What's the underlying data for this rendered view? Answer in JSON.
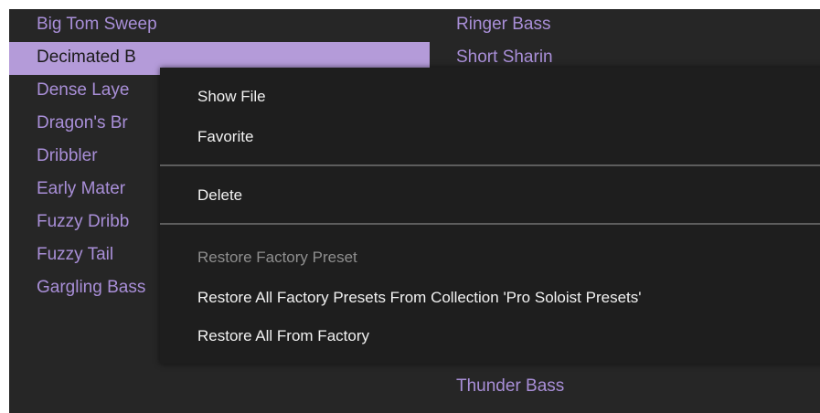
{
  "presets_left": [
    {
      "label": "Big Tom Sweep",
      "selected": false
    },
    {
      "label": "Decimated B",
      "selected": true
    },
    {
      "label": "Dense Laye",
      "selected": false
    },
    {
      "label": "Dragon's Br",
      "selected": false
    },
    {
      "label": "Dribbler",
      "selected": false
    },
    {
      "label": "Early Mater",
      "selected": false
    },
    {
      "label": "Fuzzy Dribb",
      "selected": false
    },
    {
      "label": "Fuzzy Tail",
      "selected": false
    },
    {
      "label": "Gargling Bass",
      "selected": false
    }
  ],
  "presets_right": [
    {
      "label": "Ringer Bass"
    },
    {
      "label": "Short Sharin"
    },
    {
      "label": "Thunder Bass"
    }
  ],
  "context_menu": {
    "show_file": "Show File",
    "favorite": "Favorite",
    "delete": "Delete",
    "restore_factory_preset": "Restore Factory Preset",
    "restore_all_collection": "Restore All Factory Presets From Collection 'Pro Soloist Presets'",
    "restore_all_factory": "Restore All From Factory"
  },
  "colors": {
    "background": "#262626",
    "preset_text": "#a98fd8",
    "selected_bg": "#b49bd9",
    "menu_bg": "#1e1e1e",
    "menu_text": "#f2f2f2",
    "disabled_text": "#8e8e8e"
  }
}
